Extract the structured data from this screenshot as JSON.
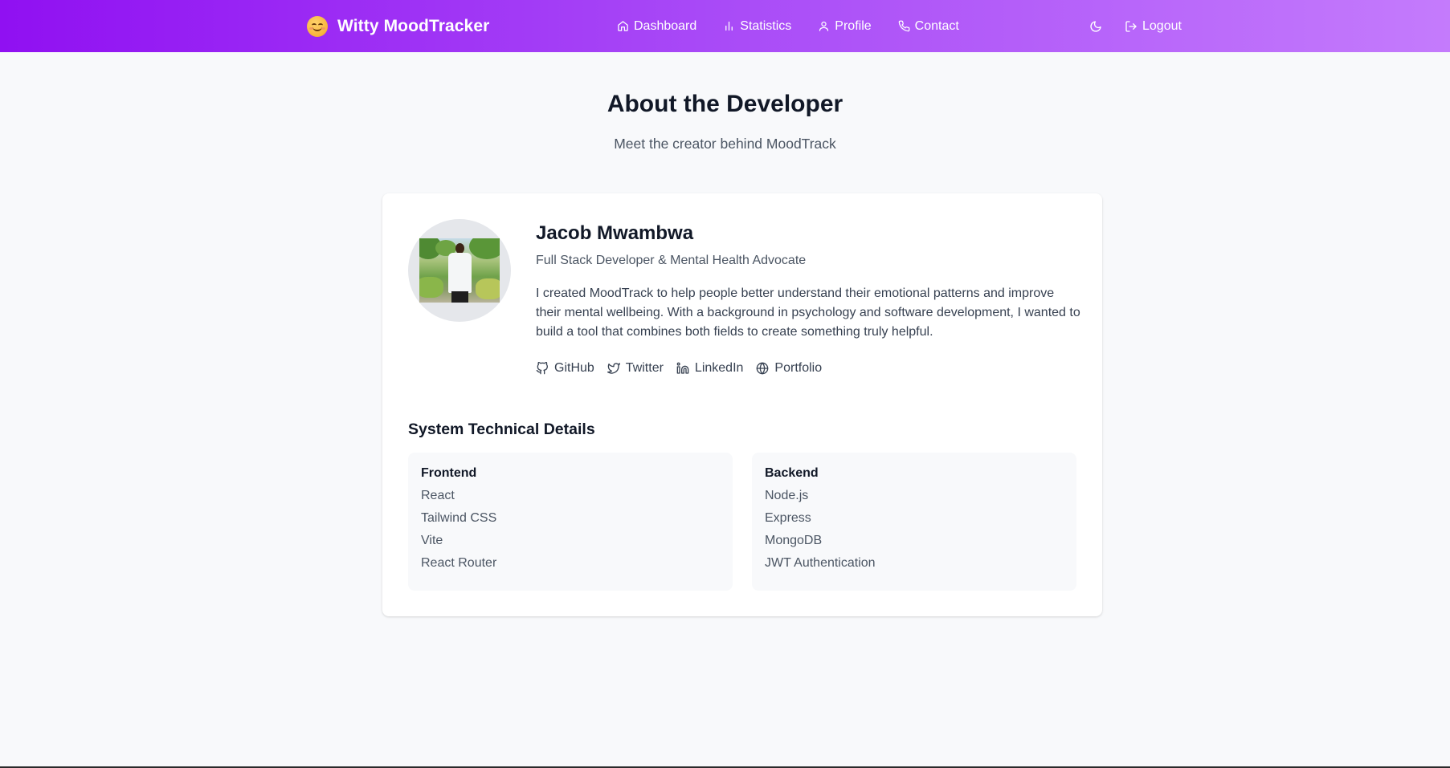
{
  "brand": {
    "name": "Witty MoodTracker",
    "icon": "smiley-emoji-icon"
  },
  "nav": {
    "links": [
      {
        "label": "Dashboard",
        "icon": "home-icon"
      },
      {
        "label": "Statistics",
        "icon": "bar-chart-icon"
      },
      {
        "label": "Profile",
        "icon": "user-icon"
      },
      {
        "label": "Contact",
        "icon": "phone-icon"
      }
    ],
    "theme_toggle_icon": "moon-icon",
    "logout_label": "Logout"
  },
  "page": {
    "title": "About the Developer",
    "subtitle": "Meet the creator behind MoodTrack"
  },
  "developer": {
    "name": "Jacob Mwambwa",
    "role": "Full Stack Developer & Mental Health Advocate",
    "bio": "I created MoodTrack to help people better understand their emotional patterns and improve their mental wellbeing. With a background in psychology and software development, I wanted to build a tool that combines both fields to create something truly helpful.",
    "socials": [
      {
        "label": "GitHub",
        "icon": "github-icon"
      },
      {
        "label": "Twitter",
        "icon": "twitter-icon"
      },
      {
        "label": "LinkedIn",
        "icon": "linkedin-icon"
      },
      {
        "label": "Portfolio",
        "icon": "globe-icon"
      }
    ]
  },
  "tech": {
    "title": "System Technical Details",
    "frontend": {
      "title": "Frontend",
      "items": [
        "React",
        "Tailwind CSS",
        "Vite",
        "React Router"
      ]
    },
    "backend": {
      "title": "Backend",
      "items": [
        "Node.js",
        "Express",
        "MongoDB",
        "JWT Authentication"
      ]
    }
  },
  "colors": {
    "nav_gradient_start": "#9010f2",
    "nav_gradient_end": "#c47bfc",
    "page_background": "#f8f9fb",
    "card_background": "#ffffff"
  }
}
